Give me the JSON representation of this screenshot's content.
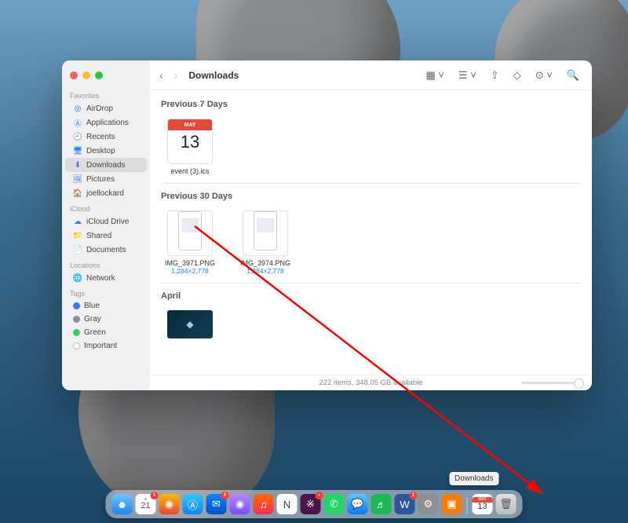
{
  "window": {
    "title": "Downloads"
  },
  "sidebar": {
    "sections": [
      {
        "label": "Favorites",
        "items": [
          {
            "icon": "airdrop-icon",
            "label": "AirDrop"
          },
          {
            "icon": "applications-icon",
            "label": "Applications"
          },
          {
            "icon": "recents-icon",
            "label": "Recents"
          },
          {
            "icon": "desktop-icon",
            "label": "Desktop"
          },
          {
            "icon": "downloads-icon",
            "label": "Downloads",
            "selected": true
          },
          {
            "icon": "pictures-icon",
            "label": "Pictures"
          },
          {
            "icon": "home-icon",
            "label": "joellockard"
          }
        ]
      },
      {
        "label": "iCloud",
        "items": [
          {
            "icon": "icloud-icon",
            "label": "iCloud Drive"
          },
          {
            "icon": "shared-icon",
            "label": "Shared"
          },
          {
            "icon": "documents-icon",
            "label": "Documents"
          }
        ]
      },
      {
        "label": "Locations",
        "items": [
          {
            "icon": "network-icon",
            "label": "Network"
          }
        ]
      },
      {
        "label": "Tags",
        "items": [
          {
            "color": "#3478f6",
            "label": "Blue"
          },
          {
            "color": "#8e8e93",
            "label": "Gray"
          },
          {
            "color": "#30d158",
            "label": "Green"
          },
          {
            "color": "#ffffff",
            "label": "Important",
            "outline": true
          }
        ]
      }
    ]
  },
  "content": {
    "groups": [
      {
        "header": "Previous 7 Days",
        "files": [
          {
            "type": "ics",
            "month": "MAY",
            "day": "13",
            "name": "event (3).ics"
          }
        ]
      },
      {
        "header": "Previous 30 Days",
        "files": [
          {
            "type": "png",
            "name": "IMG_3971.PNG",
            "dimensions": "1,284×2,778"
          },
          {
            "type": "png",
            "name": "IMG_3974.PNG",
            "dimensions": "1,284×2,778"
          }
        ]
      },
      {
        "header": "April",
        "files": [
          {
            "type": "image",
            "name": ""
          }
        ]
      }
    ]
  },
  "statusbar": {
    "text": "222 items, 348.05 GB available"
  },
  "dock": {
    "tooltip": "Downloads",
    "calendar": {
      "month": "MAY",
      "day": "13"
    },
    "minicalendar_day": "21"
  }
}
